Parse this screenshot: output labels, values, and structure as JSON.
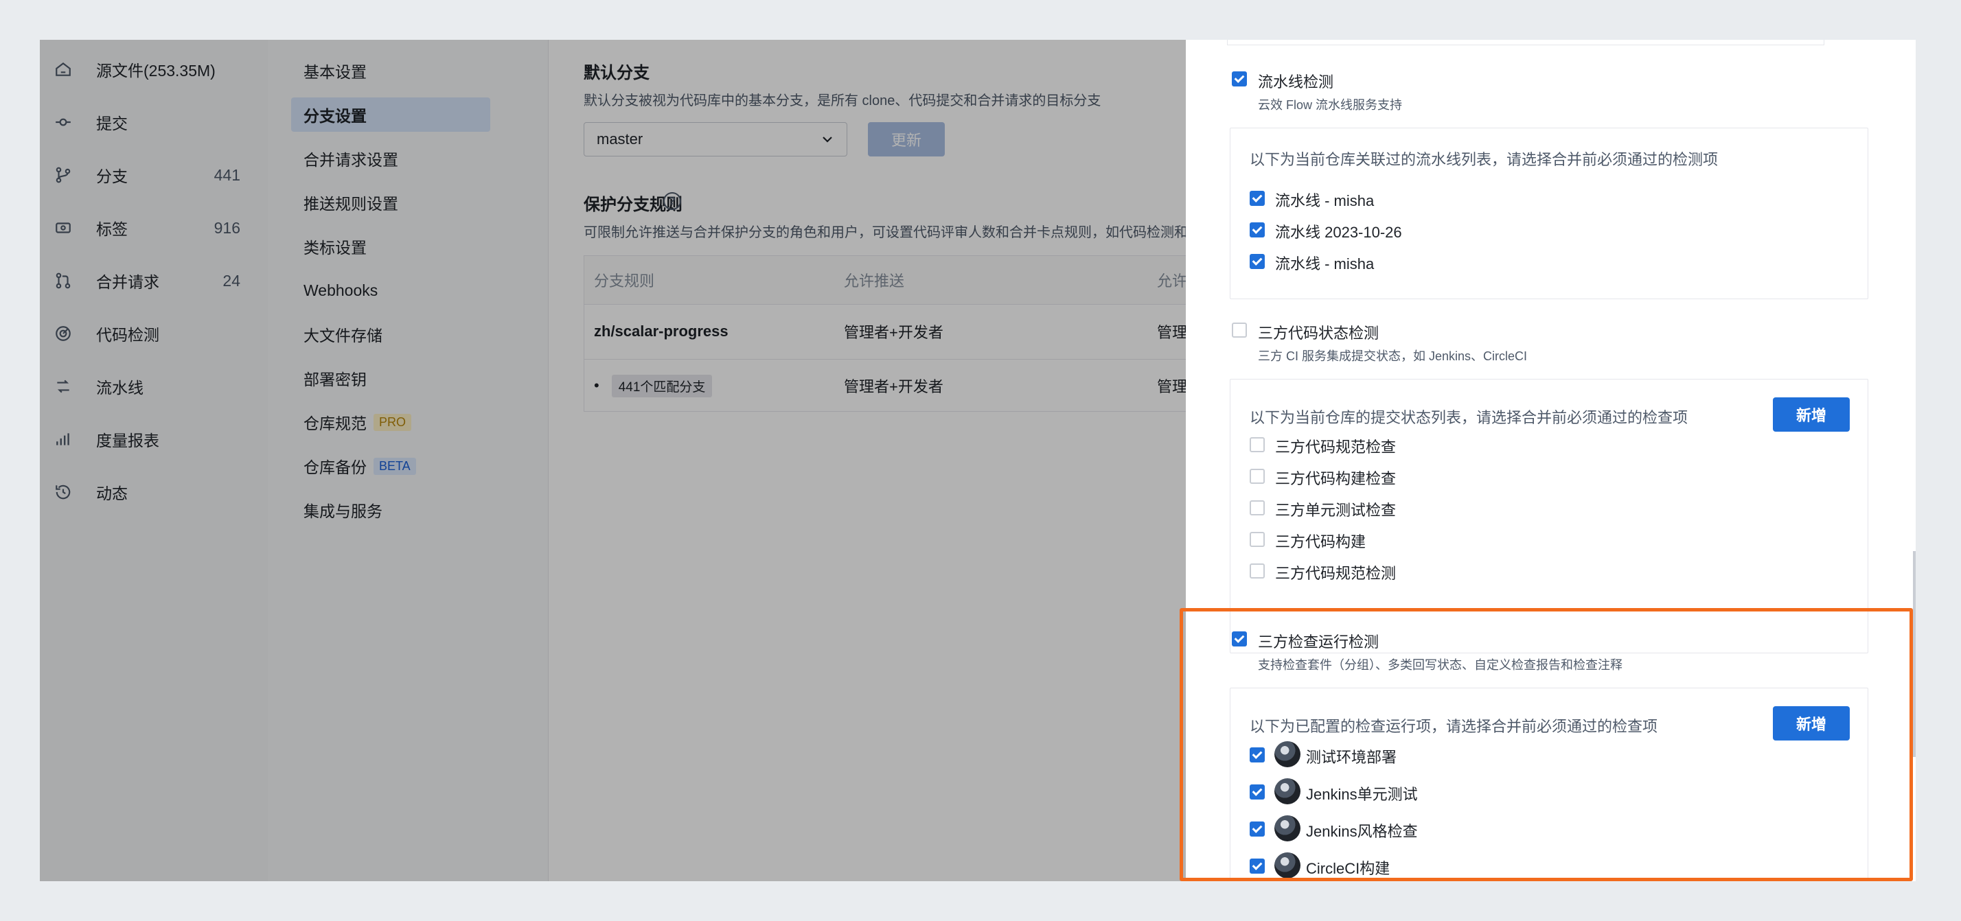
{
  "nav": {
    "items": [
      {
        "label": "源文件(253.35M)",
        "count": "",
        "icon": "home-icon"
      },
      {
        "label": "提交",
        "count": "",
        "icon": "commit-icon"
      },
      {
        "label": "分支",
        "count": "441",
        "icon": "branch-icon"
      },
      {
        "label": "标签",
        "count": "916",
        "icon": "tag-icon"
      },
      {
        "label": "合并请求",
        "count": "24",
        "icon": "merge-request-icon"
      },
      {
        "label": "代码检测",
        "count": "",
        "icon": "code-scan-icon"
      },
      {
        "label": "流水线",
        "count": "",
        "icon": "pipeline-icon"
      },
      {
        "label": "度量报表",
        "count": "",
        "icon": "chart-icon"
      },
      {
        "label": "动态",
        "count": "",
        "icon": "history-icon"
      }
    ]
  },
  "menu": {
    "items": [
      {
        "label": "基本设置"
      },
      {
        "label": "分支设置",
        "active": true
      },
      {
        "label": "合并请求设置"
      },
      {
        "label": "推送规则设置"
      },
      {
        "label": "类标设置"
      },
      {
        "label": "Webhooks"
      },
      {
        "label": "大文件存储"
      },
      {
        "label": "部署密钥"
      },
      {
        "label": "仓库规范",
        "tag": "PRO"
      },
      {
        "label": "仓库备份",
        "tag": "BETA"
      },
      {
        "label": "集成与服务"
      }
    ]
  },
  "main": {
    "default_branch": {
      "title": "默认分支",
      "desc": "默认分支被视为代码库中的基本分支，是所有 clone、代码提交和合并请求的目标分支",
      "value": "master",
      "update_label": "更新"
    },
    "protect": {
      "title": "保护分支规则",
      "help": "?",
      "desc": "可限制允许推送与合并保护分支的角色和用户，可设置代码评审人数和合并卡点规则，如代码检测和 C",
      "columns": [
        "分支规则",
        "允许推送",
        "允许合并"
      ],
      "rows": [
        {
          "rule": "zh/scalar-progress",
          "push": "管理者+开发者",
          "merge": "管理者+开"
        },
        {
          "rule_prefix": "•",
          "rule_tag": "441个匹配分支",
          "push": "管理者+开发者",
          "merge": "管理者+开"
        }
      ]
    }
  },
  "drawer": {
    "pipeline": {
      "title": "流水线检测",
      "checked": true,
      "sub": "云效 Flow 流水线服务支持",
      "panel_head": "以下为当前仓库关联过的流水线列表，请选择合并前必须通过的检测项",
      "items": [
        {
          "label": "流水线 - misha",
          "checked": true
        },
        {
          "label": "流水线 2023-10-26",
          "checked": true
        },
        {
          "label": "流水线 - misha",
          "checked": true
        }
      ]
    },
    "third_status": {
      "title": "三方代码状态检测",
      "checked": false,
      "sub": "三方 CI 服务集成提交状态，如 Jenkins、CircleCI",
      "panel_head": "以下为当前仓库的提交状态列表，请选择合并前必须通过的检查项",
      "add_label": "新增",
      "items": [
        {
          "label": "三方代码规范检查",
          "checked": false
        },
        {
          "label": "三方代码构建检查",
          "checked": false
        },
        {
          "label": "三方单元测试检查",
          "checked": false
        },
        {
          "label": "三方代码构建",
          "checked": false
        },
        {
          "label": "三方代码规范检测",
          "checked": false
        }
      ]
    },
    "third_run": {
      "title": "三方检查运行检测",
      "checked": true,
      "sub": "支持检查套件（分组）、多类回写状态、自定义检查报告和检查注释",
      "panel_head": "以下为已配置的检查运行项，请选择合并前必须通过的检查项",
      "add_label": "新增",
      "items": [
        {
          "label": "测试环境部署",
          "checked": true
        },
        {
          "label": "Jenkins单元测试",
          "checked": true
        },
        {
          "label": "Jenkins风格检查",
          "checked": true
        },
        {
          "label": "CircleCI构建",
          "checked": true
        }
      ]
    }
  },
  "colors": {
    "primary": "#1f6fd9",
    "highlight": "#f26b1d",
    "overlay": "rgba(0,0,0,0.30)"
  }
}
